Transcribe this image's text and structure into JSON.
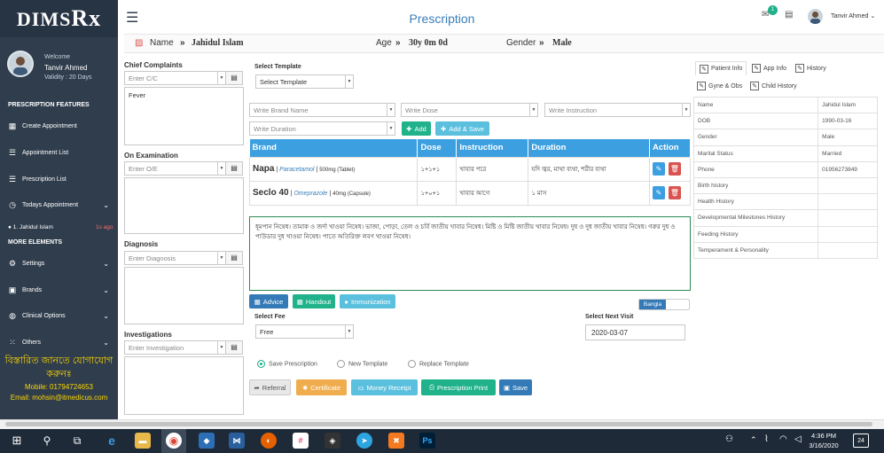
{
  "sidebar": {
    "logo": "DIMS",
    "logo_rx": "Rx",
    "welcome": "Welcome",
    "user_name": "Tanvir Ahmed",
    "validity": "Validity : 20 Days",
    "section_features": "PRESCRIPTION FEATURES",
    "items": [
      {
        "label": "Create Appointment",
        "icon": "calendar-plus-icon"
      },
      {
        "label": "Appointment List",
        "icon": "list-icon"
      },
      {
        "label": "Prescription List",
        "icon": "list-icon"
      },
      {
        "label": "Todays Appointment",
        "icon": "clock-icon"
      }
    ],
    "today_patient": "1. Jahidul Islam",
    "today_time": "1s ago",
    "section_more": "MORE ELEMENTS",
    "more_items": [
      {
        "label": "Settings",
        "icon": "gear-icon"
      },
      {
        "label": "Brands",
        "icon": "briefcase-icon"
      },
      {
        "label": "Clinical Options",
        "icon": "globe-icon"
      },
      {
        "label": "Others",
        "icon": "grid-icon"
      }
    ],
    "contact_bn": "বিস্তারিত জানতে যোগাযোগ করুনঃ",
    "contact_mobile": "Mobile: 01794724653",
    "contact_email": "Email: mohsin@itmedicus.com"
  },
  "header": {
    "title": "Prescription",
    "msg_badge": "1",
    "user": "Tanvir Ahmed"
  },
  "patient": {
    "name_label": "Name",
    "name": "Jahidul Islam",
    "age_label": "Age",
    "age": "30y 0m 0d",
    "gender_label": "Gender",
    "gender": "Male"
  },
  "left": {
    "cc_title": "Chief Complaints",
    "cc_placeholder": "Enter C/C",
    "cc_value": "Fever",
    "oe_title": "On Examination",
    "oe_placeholder": "Enter O/E",
    "dx_title": "Diagnosis",
    "dx_placeholder": "Enter Diagnosis",
    "inv_title": "Investigations",
    "inv_placeholder": "Enter Investigation"
  },
  "middle": {
    "template_label": "Select Template",
    "template_value": "Select Template",
    "brand_ph": "Write Brand Name",
    "dose_ph": "Write Dose",
    "instr_ph": "Write Instruction",
    "dur_ph": "Write Duration",
    "add": "Add",
    "add_save": "Add & Save",
    "table_headers": [
      "Brand",
      "Dose",
      "Instruction",
      "Duration",
      "Action"
    ],
    "rows": [
      {
        "brand": "Napa",
        "generic": "Paracetamol",
        "strength": "500mg (Tablet)",
        "dose": "১+১+১",
        "instruction": "খাবার পরে",
        "duration": "যদি জ্বর, মাথা ব্যথা, শরীর ব্যথা"
      },
      {
        "brand": "Seclo 40",
        "generic": "Omeprazole",
        "strength": "40mg (Capsule)",
        "dose": "১+০+১",
        "instruction": "খাবার আগে",
        "duration": "১ মাস"
      }
    ],
    "advice_text": "ধূমপান নিষেধ। তামাক ও জর্দা খাওয়া নিষেধ। ভাজা, পোড়া, তেল ও চর্বি জাতীয় খাবার নিষেধ। মিষ্টি ও মিষ্টি জাতীয় খাবার নিষেধ। দুধ ও দুধ জাতীয় খাবার নিষেধ। গরুর দুধ ও পাউডার দুধ খাওয়া নিষেধ। পাতে অতিরিক্ত লবণ খাওয়া নিষেধ।",
    "advice_btn": "Advice",
    "handout_btn": "Handout",
    "immun_btn": "Immunization",
    "bangla": "Bangla",
    "fee_label": "Select Fee",
    "fee_value": "Free",
    "next_visit_label": "Select Next Visit",
    "next_visit_value": "2020-03-07",
    "radios": [
      "Save Prescription",
      "New Template",
      "Replace Template"
    ],
    "referral": "Referral",
    "certificate": "Certificate",
    "money_receipt": "Money Receipt",
    "print": "Prescription Print",
    "save": "Save"
  },
  "right": {
    "tabs": [
      "Patient Info",
      "App Info",
      "History",
      "Gyne & Obs",
      "Child History"
    ],
    "info": [
      [
        "Name",
        "Jahidul Islam"
      ],
      [
        "DOB",
        "1990-03-16"
      ],
      [
        "Gender",
        "Male"
      ],
      [
        "Marital Status",
        "Married"
      ],
      [
        "Phone",
        "01956273849"
      ],
      [
        "Birth history",
        ""
      ],
      [
        "Health History",
        ""
      ],
      [
        "Developmental Milestones History",
        ""
      ],
      [
        "Feeding History",
        ""
      ],
      [
        "Temperament & Personality",
        ""
      ]
    ]
  },
  "taskbar": {
    "time": "4:36 PM",
    "date": "3/16/2020",
    "notif": "24"
  },
  "colors": {
    "sidebar": "#2f3d4d",
    "accent": "#3b9fe0",
    "green": "#1fb28b",
    "orange": "#f0ad4e",
    "blue": "#337ab7",
    "danger": "#d9534f"
  }
}
